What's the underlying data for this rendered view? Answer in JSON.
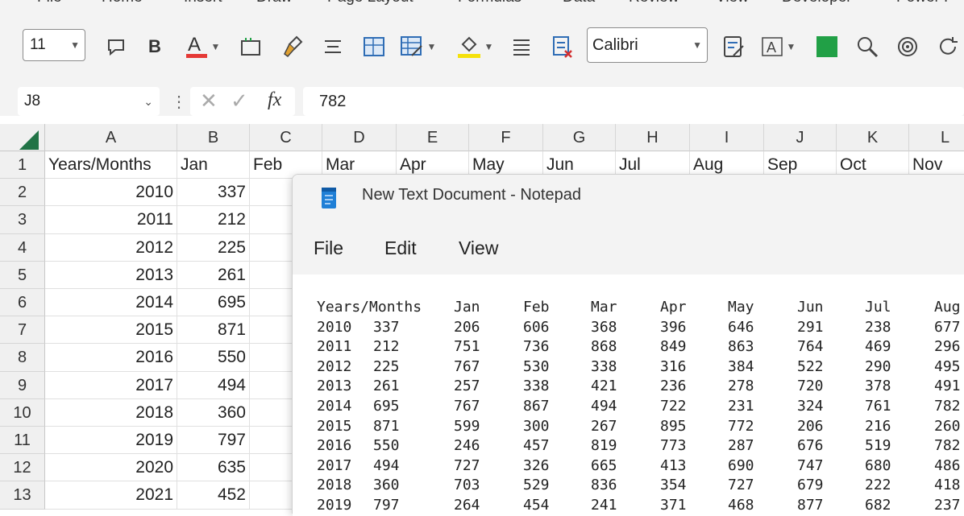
{
  "ribbon": {
    "tabs": [
      "File",
      "Home",
      "Insert",
      "Draw",
      "Page Layout",
      "Formulas",
      "Data",
      "Review",
      "View",
      "Developer",
      "Power P"
    ]
  },
  "toolbar": {
    "font_size": "11",
    "font_name": "Calibri",
    "bold_label": "B",
    "font_color": "#e53935",
    "fill_color": "#f5e10a",
    "green_color": "#21a046"
  },
  "formula_bar": {
    "name_box": "J8",
    "fx": "fx",
    "value": "782"
  },
  "sheet": {
    "columns": [
      "A",
      "B",
      "C",
      "D",
      "E",
      "F",
      "G",
      "H",
      "I",
      "J",
      "K",
      "L"
    ],
    "rows": [
      "1",
      "2",
      "3",
      "4",
      "5",
      "6",
      "7",
      "8",
      "9",
      "10",
      "11",
      "12",
      "13"
    ],
    "header_row": [
      "Years/Months",
      "Jan",
      "Feb",
      "Mar",
      "Apr",
      "May",
      "Jun",
      "Jul",
      "Aug",
      "Sep",
      "Oct",
      "Nov"
    ],
    "years": [
      "2010",
      "2011",
      "2012",
      "2013",
      "2014",
      "2015",
      "2016",
      "2017",
      "2018",
      "2019",
      "2020",
      "2021"
    ],
    "jan": [
      "337",
      "212",
      "225",
      "261",
      "695",
      "871",
      "550",
      "494",
      "360",
      "797",
      "635",
      "452"
    ]
  },
  "notepad": {
    "title": "New Text Document - Notepad",
    "menu": [
      "File",
      "Edit",
      "View"
    ],
    "headers": [
      "Years/Months",
      "Jan",
      "Feb",
      "Mar",
      "Apr",
      "May",
      "Jun",
      "Jul",
      "Aug"
    ],
    "rows": [
      [
        "2010",
        "337",
        "206",
        "606",
        "368",
        "396",
        "646",
        "291",
        "238",
        "677"
      ],
      [
        "2011",
        "212",
        "751",
        "736",
        "868",
        "849",
        "863",
        "764",
        "469",
        "296"
      ],
      [
        "2012",
        "225",
        "767",
        "530",
        "338",
        "316",
        "384",
        "522",
        "290",
        "495"
      ],
      [
        "2013",
        "261",
        "257",
        "338",
        "421",
        "236",
        "278",
        "720",
        "378",
        "491"
      ],
      [
        "2014",
        "695",
        "767",
        "867",
        "494",
        "722",
        "231",
        "324",
        "761",
        "782"
      ],
      [
        "2015",
        "871",
        "599",
        "300",
        "267",
        "895",
        "772",
        "206",
        "216",
        "260"
      ],
      [
        "2016",
        "550",
        "246",
        "457",
        "819",
        "773",
        "287",
        "676",
        "519",
        "782"
      ],
      [
        "2017",
        "494",
        "727",
        "326",
        "665",
        "413",
        "690",
        "747",
        "680",
        "486"
      ],
      [
        "2018",
        "360",
        "703",
        "529",
        "836",
        "354",
        "727",
        "679",
        "222",
        "418"
      ],
      [
        "2019",
        "797",
        "264",
        "454",
        "241",
        "371",
        "468",
        "877",
        "682",
        "237"
      ]
    ]
  }
}
